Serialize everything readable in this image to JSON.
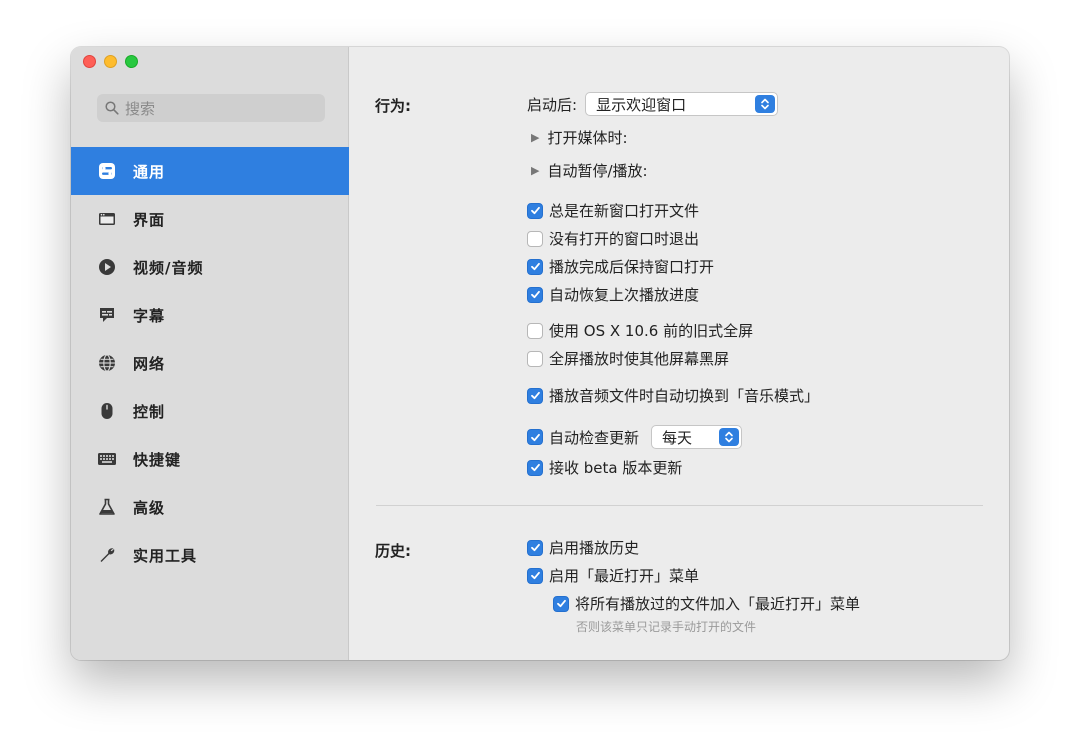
{
  "search": {
    "placeholder": "搜索"
  },
  "sidebar": {
    "items": [
      {
        "label": "通用",
        "icon": "toggles-icon",
        "active": true
      },
      {
        "label": "界面",
        "icon": "window-icon"
      },
      {
        "label": "视频/音频",
        "icon": "play-circle-icon"
      },
      {
        "label": "字幕",
        "icon": "subtitle-bubble-icon"
      },
      {
        "label": "网络",
        "icon": "globe-icon"
      },
      {
        "label": "控制",
        "icon": "mouse-icon"
      },
      {
        "label": "快捷键",
        "icon": "keyboard-icon"
      },
      {
        "label": "高级",
        "icon": "flask-icon"
      },
      {
        "label": "实用工具",
        "icon": "wrench-icon"
      }
    ]
  },
  "behavior": {
    "label": "行为:",
    "launch_label": "启动后:",
    "launch_value": "显示欢迎窗口",
    "open_media_label": "打开媒体时:",
    "auto_pause_label": "自动暂停/播放:",
    "options": [
      {
        "label": "总是在新窗口打开文件",
        "checked": true
      },
      {
        "label": "没有打开的窗口时退出",
        "checked": false
      },
      {
        "label": "播放完成后保持窗口打开",
        "checked": true
      },
      {
        "label": "自动恢复上次播放进度",
        "checked": true
      },
      {
        "label": "使用 OS X 10.6 前的旧式全屏",
        "checked": false
      },
      {
        "label": "全屏播放时使其他屏幕黑屏",
        "checked": false
      },
      {
        "label": "播放音频文件时自动切换到「音乐模式」",
        "checked": true
      },
      {
        "label": "自动检查更新",
        "checked": true
      },
      {
        "label": "接收 beta 版本更新",
        "checked": true
      }
    ],
    "update_frequency": "每天"
  },
  "history": {
    "label": "历史:",
    "options": [
      {
        "label": "启用播放历史",
        "checked": true
      },
      {
        "label": "启用「最近打开」菜单",
        "checked": true
      },
      {
        "label": "将所有播放过的文件加入「最近打开」菜单",
        "checked": true
      }
    ],
    "hint": "否则该菜单只记录手动打开的文件"
  },
  "colors": {
    "accent": "#2f7fe0",
    "sidebar": "#dcdcdc",
    "window": "#ececec"
  }
}
